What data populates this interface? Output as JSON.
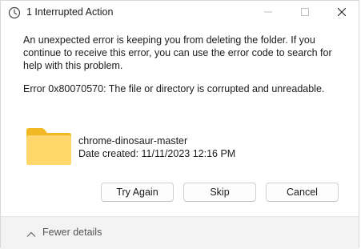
{
  "window": {
    "title": "1 Interrupted Action",
    "title_icon": "clock-icon",
    "controls": {
      "minimize": "minimize-icon",
      "maximize": "maximize-icon",
      "close": "close-icon"
    }
  },
  "dialog": {
    "message": "An unexpected error is keeping you from deleting the folder. If you continue to receive this error, you can use the error code to search for help with this problem.",
    "error": "Error 0x80070570: The file or directory is corrupted and unreadable."
  },
  "item": {
    "icon": "folder-icon",
    "name": "chrome-dinosaur-master",
    "date_created": "Date created: 11/11/2023 12:16 PM"
  },
  "buttons": {
    "try_again": "Try Again",
    "skip": "Skip",
    "cancel": "Cancel"
  },
  "footer": {
    "toggle_icon": "chevron-up-icon",
    "fewer_details": "Fewer details"
  },
  "colors": {
    "folder_light": "#FFD76A",
    "folder_dark": "#F2B824",
    "footer_bg": "#f3f3f3"
  }
}
